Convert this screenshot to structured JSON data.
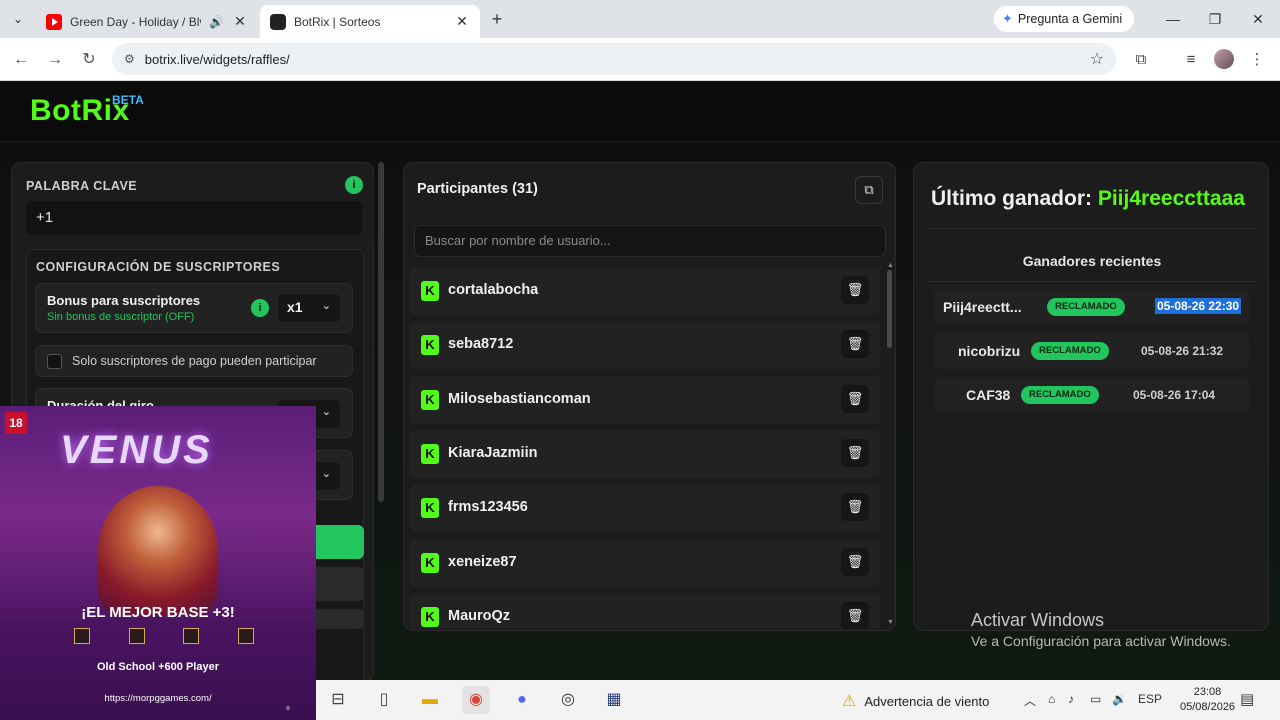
{
  "browser": {
    "tabs": [
      {
        "title": "Green Day - Holiday / Blvd.",
        "active": false,
        "audio": "🔊"
      },
      {
        "title": "BotRix | Sorteos",
        "active": true
      }
    ],
    "new_tab": "+",
    "gemini_label": "Pregunta a Gemini",
    "url": "botrix.live/widgets/raffles/"
  },
  "header": {
    "logo": "BotRix",
    "beta": "BETA"
  },
  "left_panel": {
    "keyword_label": "PALABRA CLAVE",
    "keyword_value": "+1",
    "sub_config_label": "CONFIGURACIÓN DE SUSCRIPTORES",
    "bonus_title": "Bonus para suscriptores",
    "bonus_subtitle": "Sin bonus de suscriptor (OFF)",
    "bonus_value": "x1",
    "paid_only_label": "Solo suscriptores de pago pueden participar",
    "duration_title": "Duración del giro"
  },
  "participants": {
    "title": "Participantes (31)",
    "search_placeholder": "Buscar por nombre de usuario...",
    "items": [
      "cortalabocha",
      "seba8712",
      "Milosebastiancoman",
      "KiaraJazmiin",
      "frms123456",
      "xeneize87",
      "MauroQz"
    ]
  },
  "winners": {
    "last_label": "Último ganador:",
    "last_name": "Piij4reeccttaaa",
    "recent_title": "Ganadores recientes",
    "rows": [
      {
        "name": "Piij4reectt...",
        "status": "RECLAMADO",
        "date": "05-08-26 22:30"
      },
      {
        "name": "nicobrizu",
        "status": "RECLAMADO",
        "date": "05-08-26 21:32"
      },
      {
        "name": "CAF38",
        "status": "RECLAMADO",
        "date": "05-08-26 17:04"
      }
    ]
  },
  "activate": {
    "line1": "Activar Windows",
    "line2": "Ve a Configuración para activar Windows."
  },
  "ad": {
    "age": "18",
    "logo": "VENUS",
    "headline": "¡EL MEJOR BASE +3!",
    "subline": "Old School +600 Player",
    "url": "https://morpggames.com/"
  },
  "taskbar": {
    "weather": "Advertencia de viento",
    "lang": "ESP",
    "time": "23:08",
    "date": "05/08/2026"
  }
}
